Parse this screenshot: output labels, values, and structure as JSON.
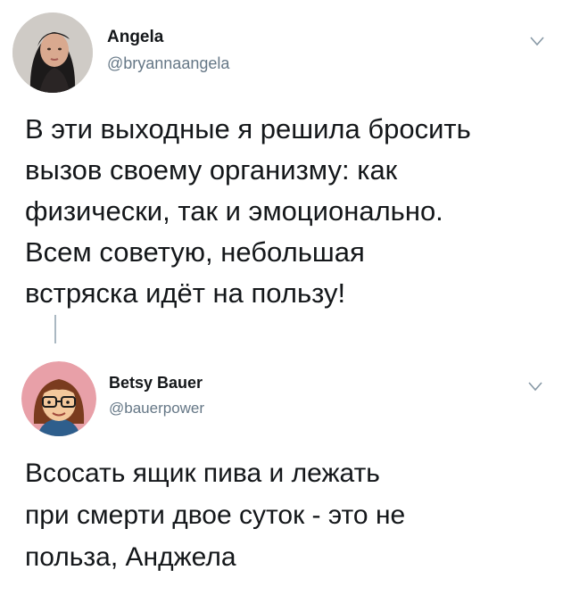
{
  "tweets": [
    {
      "name": "Angela",
      "handle": "@bryannaangela",
      "text": "В эти выходные я решила бросить\nвызов своему организму: как\nфизически, так и эмоционально.\nВсем советую, небольшая\nвстряска идёт на пользу!",
      "avatar_icon": "profile-photo-icon",
      "menu_icon": "chevron-down-icon"
    },
    {
      "name": "Betsy Bauer",
      "handle": "@bauerpower",
      "text": "Всосать ящик пива и лежать\nпри смерти двое суток - это не\nпольза,  Анджела",
      "avatar_icon": "cartoon-avatar-icon",
      "menu_icon": "chevron-down-icon"
    }
  ],
  "colors": {
    "text": "#14171a",
    "secondary": "#657786",
    "thread_line": "#aab8c2",
    "avatar2_bg": "#e8a0a8"
  }
}
